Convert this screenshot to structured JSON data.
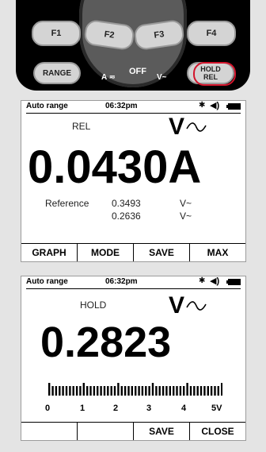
{
  "device": {
    "keys": {
      "f1": "F1",
      "f2": "F2",
      "f3": "F3",
      "f4": "F4",
      "range": "RANGE",
      "hold_line1": "HOLD",
      "hold_line2": "REL"
    },
    "dial": {
      "a_label": "A ≂",
      "off_label": "OFF",
      "v_label": "V~"
    },
    "highlight_color": "#d3152c"
  },
  "screen_rel": {
    "status": {
      "mode": "Auto range",
      "time": "06:32pm"
    },
    "mode_label": "REL",
    "unit": "V",
    "reading": "0.0430A",
    "reference_label": "Reference",
    "ref_value_1": "0.3493",
    "ref_unit_1": "V~",
    "ref_value_2": "0.2636",
    "ref_unit_2": "V~",
    "softkeys": [
      "GRAPH",
      "MODE",
      "SAVE",
      "MAX"
    ]
  },
  "screen_hold": {
    "status": {
      "mode": "Auto range",
      "time": "06:32pm"
    },
    "mode_label": "HOLD",
    "unit": "V",
    "reading": "0.2823",
    "bargraph_level": 0.9,
    "scale_labels": [
      "0",
      "1",
      "2",
      "3",
      "4",
      "5V"
    ],
    "softkeys": [
      "",
      "",
      "SAVE",
      "CLOSE"
    ]
  },
  "icons": [
    "bluetooth-icon",
    "speaker-icon",
    "battery-icon",
    "ac-wave-icon"
  ]
}
